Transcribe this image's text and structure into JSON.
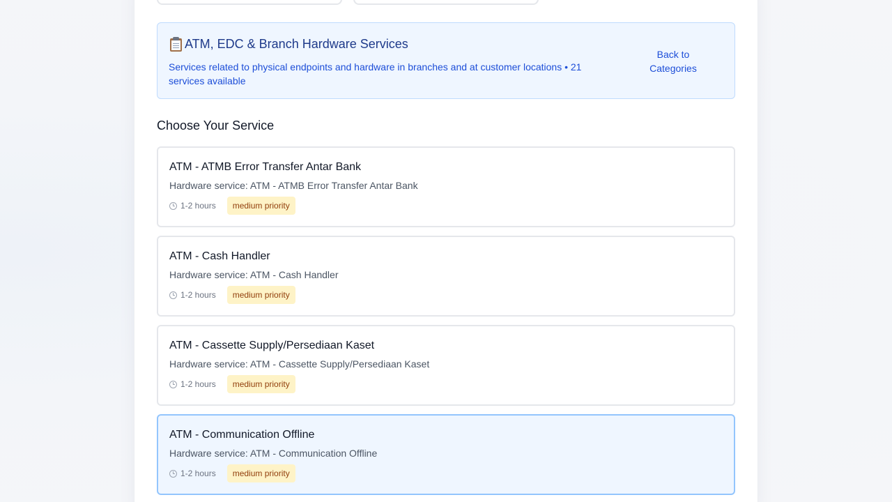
{
  "category": {
    "icon": "clipboard-icon",
    "title": "ATM, EDC & Branch Hardware Services",
    "description": "Services related to physical endpoints and hardware in branches and at customer locations • 21 services available",
    "back_label": "Back to Categories"
  },
  "section": {
    "heading": "Choose Your Service"
  },
  "services": [
    {
      "title": "ATM - ATMB Error Transfer Antar Bank",
      "description": "Hardware service: ATM - ATMB Error Transfer Antar Bank",
      "time": "1-2 hours",
      "priority": "medium priority"
    },
    {
      "title": "ATM - Cash Handler",
      "description": "Hardware service: ATM - Cash Handler",
      "time": "1-2 hours",
      "priority": "medium priority"
    },
    {
      "title": "ATM - Cassette Supply/Persediaan Kaset",
      "description": "Hardware service: ATM - Cassette Supply/Persediaan Kaset",
      "time": "1-2 hours",
      "priority": "medium priority"
    },
    {
      "title": "ATM - Communication Offline",
      "description": "Hardware service: ATM - Communication Offline",
      "time": "1-2 hours",
      "priority": "medium priority",
      "selected": true
    }
  ],
  "colors": {
    "accent": "#1d4ed8",
    "selected_bg": "#eff6ff",
    "selected_border": "#93c5fd",
    "priority_medium_bg": "#fef3c7",
    "priority_medium_text": "#92400e"
  }
}
